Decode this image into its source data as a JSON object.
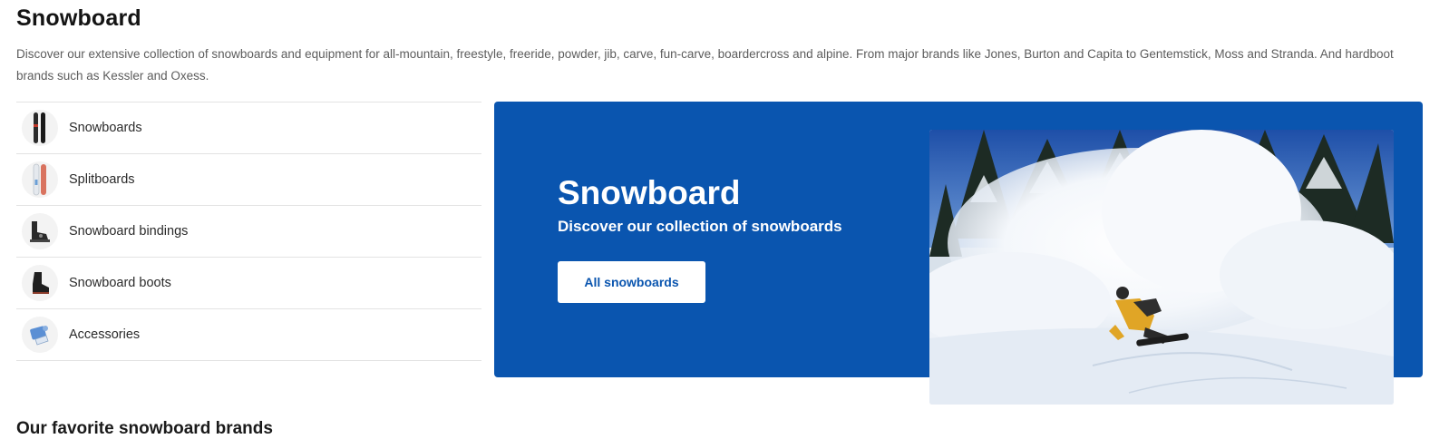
{
  "page": {
    "title": "Snowboard",
    "intro": "Discover our extensive collection of snowboards and equipment for all-mountain, freestyle, freeride, powder, jib, carve, fun-carve, boardercross and alpine. From major brands like Jones, Burton and Capita to Gentemstick, Moss and Stranda. And hardboot brands such as Kessler and Oxess."
  },
  "categories": [
    {
      "label": "Snowboards",
      "icon": "snowboards-thumbnail-icon"
    },
    {
      "label": "Splitboards",
      "icon": "splitboards-thumbnail-icon"
    },
    {
      "label": "Snowboard bindings",
      "icon": "bindings-thumbnail-icon"
    },
    {
      "label": "Snowboard boots",
      "icon": "boots-thumbnail-icon"
    },
    {
      "label": "Accessories",
      "icon": "accessories-thumbnail-icon"
    }
  ],
  "hero": {
    "title": "Snowboard",
    "subtitle": "Discover our collection of snowboards",
    "button_label": "All snowboards",
    "background_color": "#0a55af",
    "photo": "snowboarder-powder-spray-photo"
  },
  "brands_section": {
    "title": "Our favorite snowboard brands"
  }
}
